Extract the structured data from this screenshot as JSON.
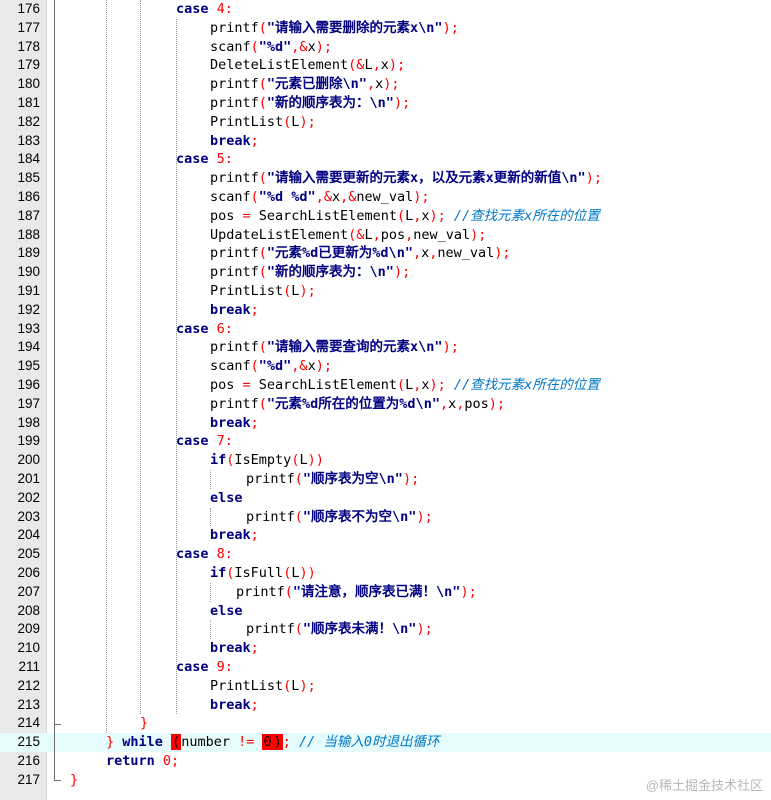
{
  "editor": {
    "lines": [
      {
        "n": "176",
        "t": [
          {
            "c": "kw",
            "v": "case "
          },
          {
            "c": "num",
            "v": "4"
          },
          {
            "c": "op",
            "v": ":"
          }
        ]
      },
      {
        "n": "177",
        "t": [
          {
            "c": "",
            "v": "printf"
          },
          {
            "c": "op",
            "v": "("
          },
          {
            "c": "strcjk",
            "v": "\"请输入需要删除的元素x\\n\""
          },
          {
            "c": "op",
            "v": ");"
          }
        ]
      },
      {
        "n": "178",
        "t": [
          {
            "c": "",
            "v": "scanf"
          },
          {
            "c": "op",
            "v": "("
          },
          {
            "c": "strcjk",
            "v": "\"%d\""
          },
          {
            "c": "op",
            "v": ",&"
          },
          {
            "c": "",
            "v": "x"
          },
          {
            "c": "op",
            "v": ");"
          }
        ]
      },
      {
        "n": "179",
        "t": [
          {
            "c": "",
            "v": "DeleteListElement"
          },
          {
            "c": "op",
            "v": "(&"
          },
          {
            "c": "",
            "v": "L"
          },
          {
            "c": "op",
            "v": ","
          },
          {
            "c": "",
            "v": "x"
          },
          {
            "c": "op",
            "v": ");"
          }
        ]
      },
      {
        "n": "180",
        "t": [
          {
            "c": "",
            "v": "printf"
          },
          {
            "c": "op",
            "v": "("
          },
          {
            "c": "strcjk",
            "v": "\"元素已删除\\n\""
          },
          {
            "c": "op",
            "v": ","
          },
          {
            "c": "",
            "v": "x"
          },
          {
            "c": "op",
            "v": ");"
          }
        ]
      },
      {
        "n": "181",
        "t": [
          {
            "c": "",
            "v": "printf"
          },
          {
            "c": "op",
            "v": "("
          },
          {
            "c": "strcjk",
            "v": "\"新的顺序表为：\\n\""
          },
          {
            "c": "op",
            "v": ");"
          }
        ]
      },
      {
        "n": "182",
        "t": [
          {
            "c": "",
            "v": "PrintList"
          },
          {
            "c": "op",
            "v": "("
          },
          {
            "c": "",
            "v": "L"
          },
          {
            "c": "op",
            "v": ");"
          }
        ]
      },
      {
        "n": "183",
        "t": [
          {
            "c": "kw",
            "v": "break"
          },
          {
            "c": "op",
            "v": ";"
          }
        ]
      },
      {
        "n": "184",
        "t": [
          {
            "c": "kw",
            "v": "case "
          },
          {
            "c": "num",
            "v": "5"
          },
          {
            "c": "op",
            "v": ":"
          }
        ]
      },
      {
        "n": "185",
        "t": [
          {
            "c": "",
            "v": "printf"
          },
          {
            "c": "op",
            "v": "("
          },
          {
            "c": "strcjk",
            "v": "\"请输入需要更新的元素x，以及元素x更新的新值\\n\""
          },
          {
            "c": "op",
            "v": ");"
          }
        ]
      },
      {
        "n": "186",
        "t": [
          {
            "c": "",
            "v": "scanf"
          },
          {
            "c": "op",
            "v": "("
          },
          {
            "c": "strcjk",
            "v": "\"%d %d\""
          },
          {
            "c": "op",
            "v": ",&"
          },
          {
            "c": "",
            "v": "x"
          },
          {
            "c": "op",
            "v": ",&"
          },
          {
            "c": "",
            "v": "new_val"
          },
          {
            "c": "op",
            "v": ");"
          }
        ]
      },
      {
        "n": "187",
        "t": [
          {
            "c": "",
            "v": "pos "
          },
          {
            "c": "op",
            "v": "= "
          },
          {
            "c": "",
            "v": "SearchListElement"
          },
          {
            "c": "op",
            "v": "("
          },
          {
            "c": "",
            "v": "L"
          },
          {
            "c": "op",
            "v": ","
          },
          {
            "c": "",
            "v": "x"
          },
          {
            "c": "op",
            "v": "); "
          },
          {
            "c": "cmt",
            "v": "//查找元素x所在的位置"
          }
        ]
      },
      {
        "n": "188",
        "t": [
          {
            "c": "",
            "v": "UpdateListElement"
          },
          {
            "c": "op",
            "v": "(&"
          },
          {
            "c": "",
            "v": "L"
          },
          {
            "c": "op",
            "v": ","
          },
          {
            "c": "",
            "v": "pos"
          },
          {
            "c": "op",
            "v": ","
          },
          {
            "c": "",
            "v": "new_val"
          },
          {
            "c": "op",
            "v": ");"
          }
        ]
      },
      {
        "n": "189",
        "t": [
          {
            "c": "",
            "v": "printf"
          },
          {
            "c": "op",
            "v": "("
          },
          {
            "c": "strcjk",
            "v": "\"元素%d已更新为%d\\n\""
          },
          {
            "c": "op",
            "v": ","
          },
          {
            "c": "",
            "v": "x"
          },
          {
            "c": "op",
            "v": ","
          },
          {
            "c": "",
            "v": "new_val"
          },
          {
            "c": "op",
            "v": ");"
          }
        ]
      },
      {
        "n": "190",
        "t": [
          {
            "c": "",
            "v": "printf"
          },
          {
            "c": "op",
            "v": "("
          },
          {
            "c": "strcjk",
            "v": "\"新的顺序表为：\\n\""
          },
          {
            "c": "op",
            "v": ");"
          }
        ]
      },
      {
        "n": "191",
        "t": [
          {
            "c": "",
            "v": "PrintList"
          },
          {
            "c": "op",
            "v": "("
          },
          {
            "c": "",
            "v": "L"
          },
          {
            "c": "op",
            "v": ");"
          }
        ]
      },
      {
        "n": "192",
        "t": [
          {
            "c": "kw",
            "v": "break"
          },
          {
            "c": "op",
            "v": ";"
          }
        ]
      },
      {
        "n": "193",
        "t": [
          {
            "c": "kw",
            "v": "case "
          },
          {
            "c": "num",
            "v": "6"
          },
          {
            "c": "op",
            "v": ":"
          }
        ]
      },
      {
        "n": "194",
        "t": [
          {
            "c": "",
            "v": "printf"
          },
          {
            "c": "op",
            "v": "("
          },
          {
            "c": "strcjk",
            "v": "\"请输入需要查询的元素x\\n\""
          },
          {
            "c": "op",
            "v": ");"
          }
        ]
      },
      {
        "n": "195",
        "t": [
          {
            "c": "",
            "v": "scanf"
          },
          {
            "c": "op",
            "v": "("
          },
          {
            "c": "strcjk",
            "v": "\"%d\""
          },
          {
            "c": "op",
            "v": ",&"
          },
          {
            "c": "",
            "v": "x"
          },
          {
            "c": "op",
            "v": ");"
          }
        ]
      },
      {
        "n": "196",
        "t": [
          {
            "c": "",
            "v": "pos "
          },
          {
            "c": "op",
            "v": "= "
          },
          {
            "c": "",
            "v": "SearchListElement"
          },
          {
            "c": "op",
            "v": "("
          },
          {
            "c": "",
            "v": "L"
          },
          {
            "c": "op",
            "v": ","
          },
          {
            "c": "",
            "v": "x"
          },
          {
            "c": "op",
            "v": "); "
          },
          {
            "c": "cmt",
            "v": "//查找元素x所在的位置"
          }
        ]
      },
      {
        "n": "197",
        "t": [
          {
            "c": "",
            "v": "printf"
          },
          {
            "c": "op",
            "v": "("
          },
          {
            "c": "strcjk",
            "v": "\"元素%d所在的位置为%d\\n\""
          },
          {
            "c": "op",
            "v": ","
          },
          {
            "c": "",
            "v": "x"
          },
          {
            "c": "op",
            "v": ","
          },
          {
            "c": "",
            "v": "pos"
          },
          {
            "c": "op",
            "v": ");"
          }
        ]
      },
      {
        "n": "198",
        "t": [
          {
            "c": "kw",
            "v": "break"
          },
          {
            "c": "op",
            "v": ";"
          }
        ]
      },
      {
        "n": "199",
        "t": [
          {
            "c": "kw",
            "v": "case "
          },
          {
            "c": "num",
            "v": "7"
          },
          {
            "c": "op",
            "v": ":"
          }
        ]
      },
      {
        "n": "200",
        "t": [
          {
            "c": "kw",
            "v": "if"
          },
          {
            "c": "op",
            "v": "("
          },
          {
            "c": "",
            "v": "IsEmpty"
          },
          {
            "c": "op",
            "v": "("
          },
          {
            "c": "",
            "v": "L"
          },
          {
            "c": "op",
            "v": "))"
          }
        ]
      },
      {
        "n": "201",
        "t": [
          {
            "c": "",
            "v": "printf"
          },
          {
            "c": "op",
            "v": "("
          },
          {
            "c": "strcjk",
            "v": "\"顺序表为空\\n\""
          },
          {
            "c": "op",
            "v": ");"
          }
        ]
      },
      {
        "n": "202",
        "t": [
          {
            "c": "kw",
            "v": "else"
          }
        ]
      },
      {
        "n": "203",
        "t": [
          {
            "c": "",
            "v": "printf"
          },
          {
            "c": "op",
            "v": "("
          },
          {
            "c": "strcjk",
            "v": "\"顺序表不为空\\n\""
          },
          {
            "c": "op",
            "v": ");"
          }
        ]
      },
      {
        "n": "204",
        "t": [
          {
            "c": "kw",
            "v": "break"
          },
          {
            "c": "op",
            "v": ";"
          }
        ]
      },
      {
        "n": "205",
        "t": [
          {
            "c": "kw",
            "v": "case "
          },
          {
            "c": "num",
            "v": "8"
          },
          {
            "c": "op",
            "v": ":"
          }
        ]
      },
      {
        "n": "206",
        "t": [
          {
            "c": "kw",
            "v": "if"
          },
          {
            "c": "op",
            "v": "("
          },
          {
            "c": "",
            "v": "IsFull"
          },
          {
            "c": "op",
            "v": "("
          },
          {
            "c": "",
            "v": "L"
          },
          {
            "c": "op",
            "v": "))"
          }
        ]
      },
      {
        "n": "207",
        "t": [
          {
            "c": "",
            "v": "printf"
          },
          {
            "c": "op",
            "v": "("
          },
          {
            "c": "strcjk",
            "v": "\"请注意，顺序表已满！\\n\""
          },
          {
            "c": "op",
            "v": ");"
          }
        ]
      },
      {
        "n": "208",
        "t": [
          {
            "c": "kw",
            "v": "else"
          }
        ]
      },
      {
        "n": "209",
        "t": [
          {
            "c": "",
            "v": "printf"
          },
          {
            "c": "op",
            "v": "("
          },
          {
            "c": "strcjk",
            "v": "\"顺序表未满！\\n\""
          },
          {
            "c": "op",
            "v": ");"
          }
        ]
      },
      {
        "n": "210",
        "t": [
          {
            "c": "kw",
            "v": "break"
          },
          {
            "c": "op",
            "v": ";"
          }
        ]
      },
      {
        "n": "211",
        "t": [
          {
            "c": "kw",
            "v": "case "
          },
          {
            "c": "num",
            "v": "9"
          },
          {
            "c": "op",
            "v": ":"
          }
        ]
      },
      {
        "n": "212",
        "t": [
          {
            "c": "",
            "v": "PrintList"
          },
          {
            "c": "op",
            "v": "("
          },
          {
            "c": "",
            "v": "L"
          },
          {
            "c": "op",
            "v": ");"
          }
        ]
      },
      {
        "n": "213",
        "t": [
          {
            "c": "kw",
            "v": "break"
          },
          {
            "c": "op",
            "v": ";"
          }
        ]
      },
      {
        "n": "214",
        "t": [
          {
            "c": "op",
            "v": "}"
          }
        ]
      },
      {
        "n": "215",
        "t": [
          {
            "c": "op",
            "v": "} "
          },
          {
            "c": "kw",
            "v": "while "
          },
          {
            "c": "hl",
            "v": "("
          },
          {
            "c": "",
            "v": "number "
          },
          {
            "c": "op",
            "v": "!= "
          },
          {
            "c": "numhl",
            "v": "0"
          },
          {
            "c": "hl",
            "v": ")"
          },
          {
            "c": "op",
            "v": "; "
          },
          {
            "c": "cmt",
            "v": "// 当输入0时退出循环"
          }
        ]
      },
      {
        "n": "216",
        "t": [
          {
            "c": "kw",
            "v": "return "
          },
          {
            "c": "num",
            "v": "0"
          },
          {
            "c": "op",
            "v": ";"
          }
        ]
      },
      {
        "n": "217",
        "t": [
          {
            "c": "op",
            "v": "}"
          }
        ]
      }
    ],
    "current_line": "215"
  },
  "watermark": "@稀土掘金技术社区",
  "colors": {
    "keyword": "#000080",
    "number": "#ff0000",
    "comment": "#0077c8",
    "current_line_bg": "#e6fbfb",
    "gutter_bg": "#e9e9e9",
    "brace_highlight": "#ff0000"
  }
}
